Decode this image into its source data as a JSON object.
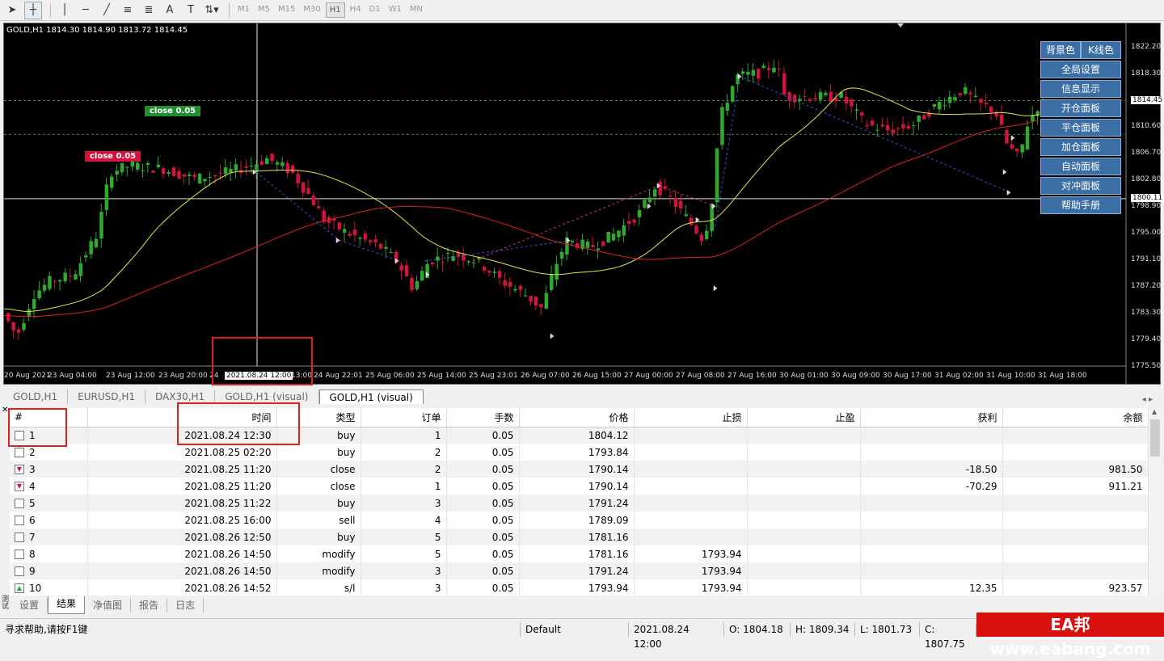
{
  "toolbar": {
    "timeframes": [
      "M1",
      "M5",
      "M15",
      "M30",
      "H1",
      "H4",
      "D1",
      "W1",
      "MN"
    ],
    "active_timeframe": "H1"
  },
  "chart": {
    "info": "GOLD,H1  1814.30 1814.90 1813.72 1814.45",
    "price_ticks": [
      "1822.20",
      "1818.30",
      "1814.45",
      "1810.60",
      "1806.70",
      "1802.80",
      "1800.11",
      "1798.90",
      "1795.00",
      "1791.10",
      "1787.20",
      "1783.30",
      "1779.40",
      "1775.50"
    ],
    "current_price": "1814.45",
    "crosshair_price": "1800.11",
    "time_ticks": [
      "20 Aug 2021",
      "23 Aug 04:00",
      "23 Aug 12:00",
      "23 Aug 20:00",
      "24",
      "13:00",
      "24 Aug 22:01",
      "25 Aug 06:00",
      "25 Aug 14:00",
      "25 Aug 23:01",
      "26 Aug 07:00",
      "26 Aug 15:00",
      "27 Aug 00:00",
      "27 Aug 08:00",
      "27 Aug 16:00",
      "30 Aug 01:00",
      "30 Aug 09:00",
      "30 Aug 17:00",
      "31 Aug 02:00",
      "31 Aug 10:00",
      "31 Aug 18:00"
    ],
    "crosshair_time": "2021.08.24 12:00",
    "close_tag_green": "close 0.05",
    "close_tag_red": "close 0.05",
    "panel": {
      "bg_color_btn": "背景色",
      "k_color_btn": "K线色",
      "buttons": [
        "全局设置",
        "信息显示",
        "开仓面板",
        "平仓面板",
        "加仓面板",
        "自动面板",
        "对冲面板",
        "帮助手册"
      ]
    }
  },
  "chart_tabs": [
    "GOLD,H1",
    "EURUSD,H1",
    "DAX30,H1",
    "GOLD,H1 (visual)",
    "GOLD,H1 (visual)"
  ],
  "table": {
    "headers": [
      "#",
      "时间",
      "类型",
      "订单",
      "手数",
      "价格",
      "止损",
      "止盈",
      "获利",
      "余额"
    ],
    "rows": [
      [
        "1",
        "2021.08.24 12:30",
        "buy",
        "1",
        "0.05",
        "1804.12",
        "",
        "",
        "",
        ""
      ],
      [
        "2",
        "2021.08.25 02:20",
        "buy",
        "2",
        "0.05",
        "1793.84",
        "",
        "",
        "",
        ""
      ],
      [
        "3",
        "2021.08.25 11:20",
        "close",
        "2",
        "0.05",
        "1790.14",
        "",
        "",
        "-18.50",
        "981.50"
      ],
      [
        "4",
        "2021.08.25 11:20",
        "close",
        "1",
        "0.05",
        "1790.14",
        "",
        "",
        "-70.29",
        "911.21"
      ],
      [
        "5",
        "2021.08.25 11:22",
        "buy",
        "3",
        "0.05",
        "1791.24",
        "",
        "",
        "",
        ""
      ],
      [
        "6",
        "2021.08.25 16:00",
        "sell",
        "4",
        "0.05",
        "1789.09",
        "",
        "",
        "",
        ""
      ],
      [
        "7",
        "2021.08.26 12:50",
        "buy",
        "5",
        "0.05",
        "1781.16",
        "",
        "",
        "",
        ""
      ],
      [
        "8",
        "2021.08.26 14:50",
        "modify",
        "5",
        "0.05",
        "1781.16",
        "1793.94",
        "",
        "",
        ""
      ],
      [
        "9",
        "2021.08.26 14:50",
        "modify",
        "3",
        "0.05",
        "1791.24",
        "1793.94",
        "",
        "",
        ""
      ],
      [
        "10",
        "2021.08.26 14:52",
        "s/l",
        "3",
        "0.05",
        "1793.94",
        "1793.94",
        "",
        "12.35",
        "923.57"
      ]
    ]
  },
  "side_label": "测试器",
  "bottom_tabs": [
    "设置",
    "结果",
    "净值图",
    "报告",
    "日志"
  ],
  "active_bottom_tab": "结果",
  "status": {
    "help": "寻求帮助,请按F1键",
    "profile": "Default",
    "datetime": "2021.08.24 12:00",
    "open": "O: 1804.18",
    "high": "H: 1809.34",
    "low": "L: 1801.73",
    "close": "C: 1807.75"
  },
  "watermark": "EA邦 www.eabang.com",
  "colors": {
    "bull": "#2eaa2e",
    "bear": "#d0143c",
    "ma_fast": "#e6e640",
    "ma_slow": "#e02020",
    "panel_btn": "#3a6ea5"
  }
}
